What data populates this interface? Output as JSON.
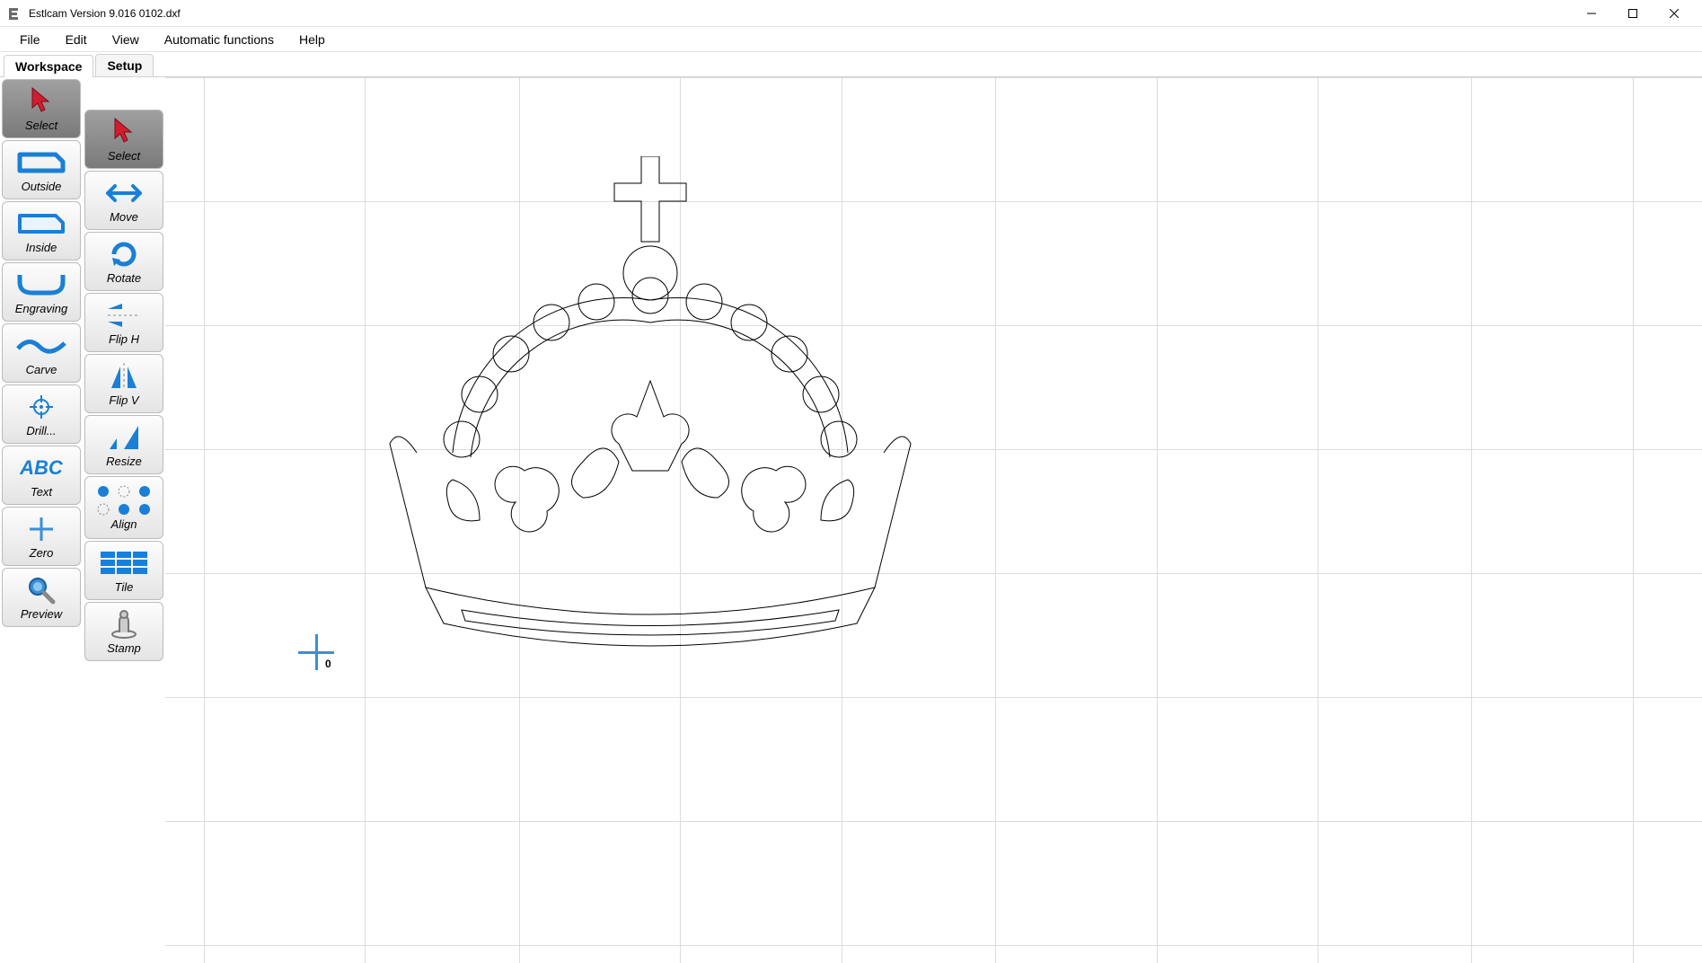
{
  "window": {
    "title": "Estlcam Version 9.016 0102.dxf"
  },
  "menubar": {
    "items": [
      "File",
      "Edit",
      "View",
      "Automatic functions",
      "Help"
    ]
  },
  "tabs": {
    "items": [
      "Workspace",
      "Setup"
    ],
    "active": 0
  },
  "toolbar_primary": [
    {
      "id": "select",
      "label": "Select",
      "active": true
    },
    {
      "id": "outside",
      "label": "Outside"
    },
    {
      "id": "inside",
      "label": "Inside"
    },
    {
      "id": "engraving",
      "label": "Engraving"
    },
    {
      "id": "carve",
      "label": "Carve"
    },
    {
      "id": "drill",
      "label": "Drill..."
    },
    {
      "id": "text",
      "label": "Text"
    },
    {
      "id": "zero",
      "label": "Zero"
    },
    {
      "id": "preview",
      "label": "Preview"
    }
  ],
  "toolbar_secondary": [
    {
      "id": "select2",
      "label": "Select",
      "active": true
    },
    {
      "id": "move",
      "label": "Move"
    },
    {
      "id": "rotate",
      "label": "Rotate"
    },
    {
      "id": "fliph",
      "label": "Flip H"
    },
    {
      "id": "flipv",
      "label": "Flip V"
    },
    {
      "id": "resize",
      "label": "Resize"
    },
    {
      "id": "align",
      "label": "Align"
    },
    {
      "id": "tile",
      "label": "Tile"
    },
    {
      "id": "stamp",
      "label": "Stamp"
    }
  ],
  "canvas": {
    "origin_label": "0"
  }
}
